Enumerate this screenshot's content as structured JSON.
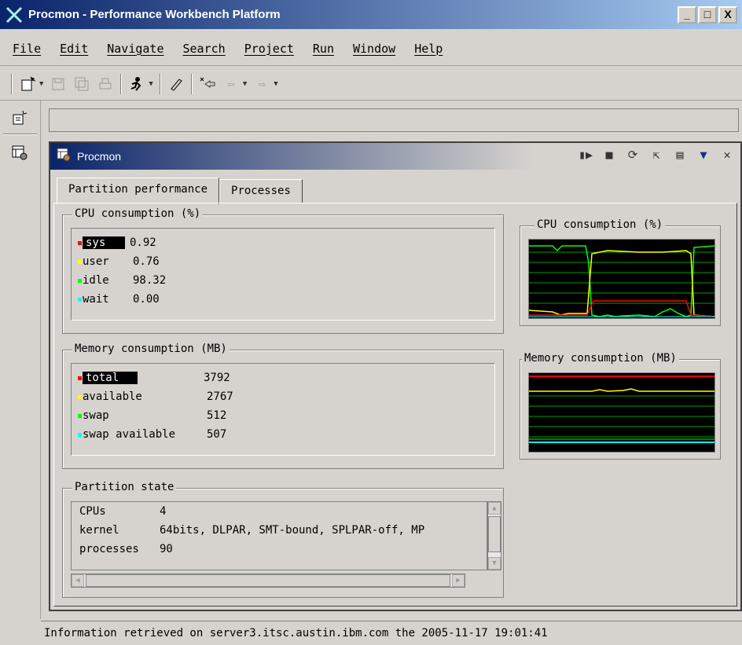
{
  "window": {
    "title": "Procmon - Performance Workbench Platform",
    "controls": [
      "_",
      "□",
      "X"
    ]
  },
  "menu": [
    "File",
    "Edit",
    "Navigate",
    "Search",
    "Project",
    "Run",
    "Window",
    "Help"
  ],
  "view": {
    "title": "Procmon",
    "tabs": [
      "Partition performance",
      "Processes"
    ]
  },
  "cpu": {
    "group_label": "CPU consumption (%)",
    "rows": [
      {
        "name": "sys",
        "value": "0.92",
        "color": "#ff0000"
      },
      {
        "name": "user",
        "value": "0.76",
        "color": "#ffff00"
      },
      {
        "name": "idle",
        "value": "98.32",
        "color": "#00ff00"
      },
      {
        "name": "wait",
        "value": "0.00",
        "color": "#00ffff"
      }
    ]
  },
  "memory": {
    "group_label": "Memory consumption (MB)",
    "rows": [
      {
        "name": "total",
        "value": "3792",
        "color": "#ff0000"
      },
      {
        "name": "available",
        "value": "2767",
        "color": "#ffff00"
      },
      {
        "name": "swap",
        "value": "512",
        "color": "#00ff00"
      },
      {
        "name": "swap available",
        "value": "507",
        "color": "#00ffff"
      }
    ]
  },
  "partition_state": {
    "group_label": "Partition state",
    "rows": [
      {
        "key": "CPUs",
        "value": "4"
      },
      {
        "key": "kernel",
        "value": "64bits, DLPAR, SMT-bound, SPLPAR-off, MP"
      },
      {
        "key": "processes",
        "value": "90"
      }
    ]
  },
  "graphs": {
    "cpu_title": "CPU consumption (%)",
    "memory_title": "Memory consumption (MB)"
  },
  "status": "Information retrieved on server3.itsc.austin.ibm.com the 2005-11-17 19:01:41"
}
